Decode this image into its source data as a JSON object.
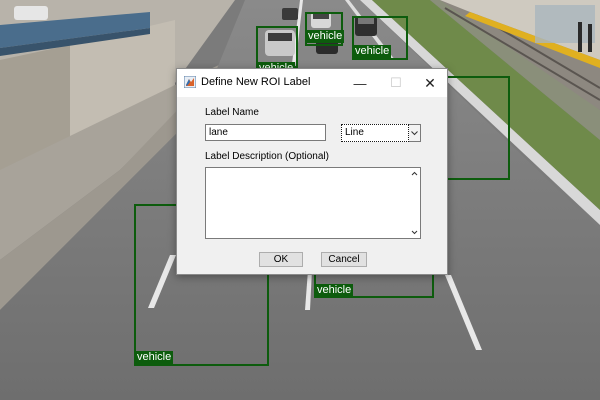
{
  "roi_labels": [
    "vehicle",
    "vehicle",
    "vehicle",
    "vehicle",
    "vehicle"
  ],
  "dialog": {
    "title": "Define New ROI Label",
    "label_name_caption": "Label Name",
    "label_name_value": "lane",
    "type_select_value": "Line",
    "description_caption": "Label Description (Optional)",
    "description_value": "",
    "ok_label": "OK",
    "cancel_label": "Cancel",
    "minimize_glyph": "—",
    "maximize_glyph": "☐",
    "close_glyph": "✕"
  },
  "colors": {
    "roi_box": "#0d5c0d",
    "label_bg": "#0d5c0d",
    "dialog_bg": "#f0f0f0"
  },
  "icons": {
    "dialog_app_icon": "matlab-icon",
    "select_arrow": "chevron-down-icon",
    "scroll_up": "chevron-up-icon",
    "scroll_down": "chevron-down-icon"
  }
}
